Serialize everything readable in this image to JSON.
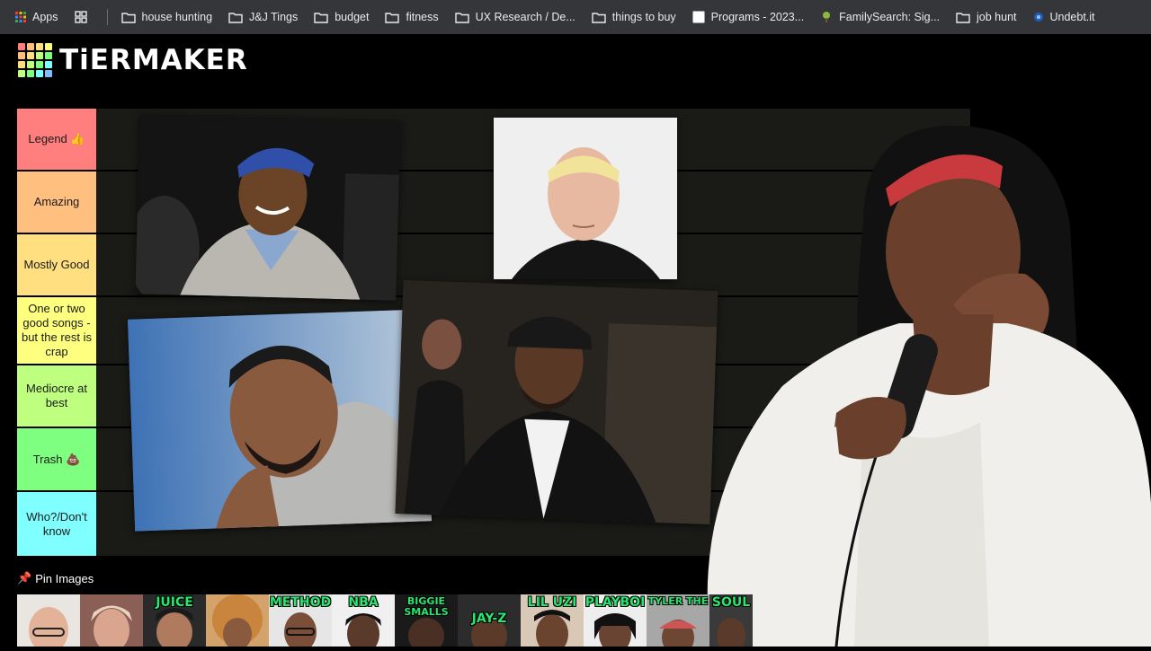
{
  "bookmarks": [
    {
      "label": "Apps",
      "icon": "apps-grid-icon"
    },
    {
      "label": "",
      "icon": "grid-icon"
    },
    {
      "label": "house hunting",
      "icon": "folder-icon"
    },
    {
      "label": "J&J Tings",
      "icon": "folder-icon"
    },
    {
      "label": "budget",
      "icon": "folder-icon"
    },
    {
      "label": "fitness",
      "icon": "folder-icon"
    },
    {
      "label": "UX Research / De...",
      "icon": "folder-icon"
    },
    {
      "label": "things to buy",
      "icon": "folder-icon"
    },
    {
      "label": "Programs - 2023...",
      "icon": "page-icon"
    },
    {
      "label": "FamilySearch: Sig...",
      "icon": "tree-icon"
    },
    {
      "label": "job hunt",
      "icon": "folder-icon"
    },
    {
      "label": "Undebt.it",
      "icon": "undebt-icon"
    }
  ],
  "logo": {
    "text": "TiERMAKER"
  },
  "tiers": [
    {
      "label": "Legend 👍",
      "color": "#ff7f7f"
    },
    {
      "label": "Amazing",
      "color": "#ffbf7f"
    },
    {
      "label": "Mostly Good",
      "color": "#ffdf7f"
    },
    {
      "label": "One or two good songs - but the rest is crap",
      "color": "#ffff7f"
    },
    {
      "label": "Mediocre at best",
      "color": "#bfff7f"
    },
    {
      "label": "Trash 💩",
      "color": "#7fff7f"
    },
    {
      "label": "Who?/Don't know",
      "color": "#7fffff"
    }
  ],
  "pin": {
    "label": "Pin Images",
    "icon": "pushpin-icon"
  },
  "thumbnails": [
    {
      "caption": ""
    },
    {
      "caption": ""
    },
    {
      "caption": "JUICE"
    },
    {
      "caption": ""
    },
    {
      "caption": "METHOD"
    },
    {
      "caption": "NBA"
    },
    {
      "caption": "BIGGIE SMALLS"
    },
    {
      "caption": "JAY-Z"
    },
    {
      "caption": "LIL UZI"
    },
    {
      "caption": "PLAYBOI"
    },
    {
      "caption": "TYLER THE"
    },
    {
      "caption": "SOUL"
    }
  ]
}
